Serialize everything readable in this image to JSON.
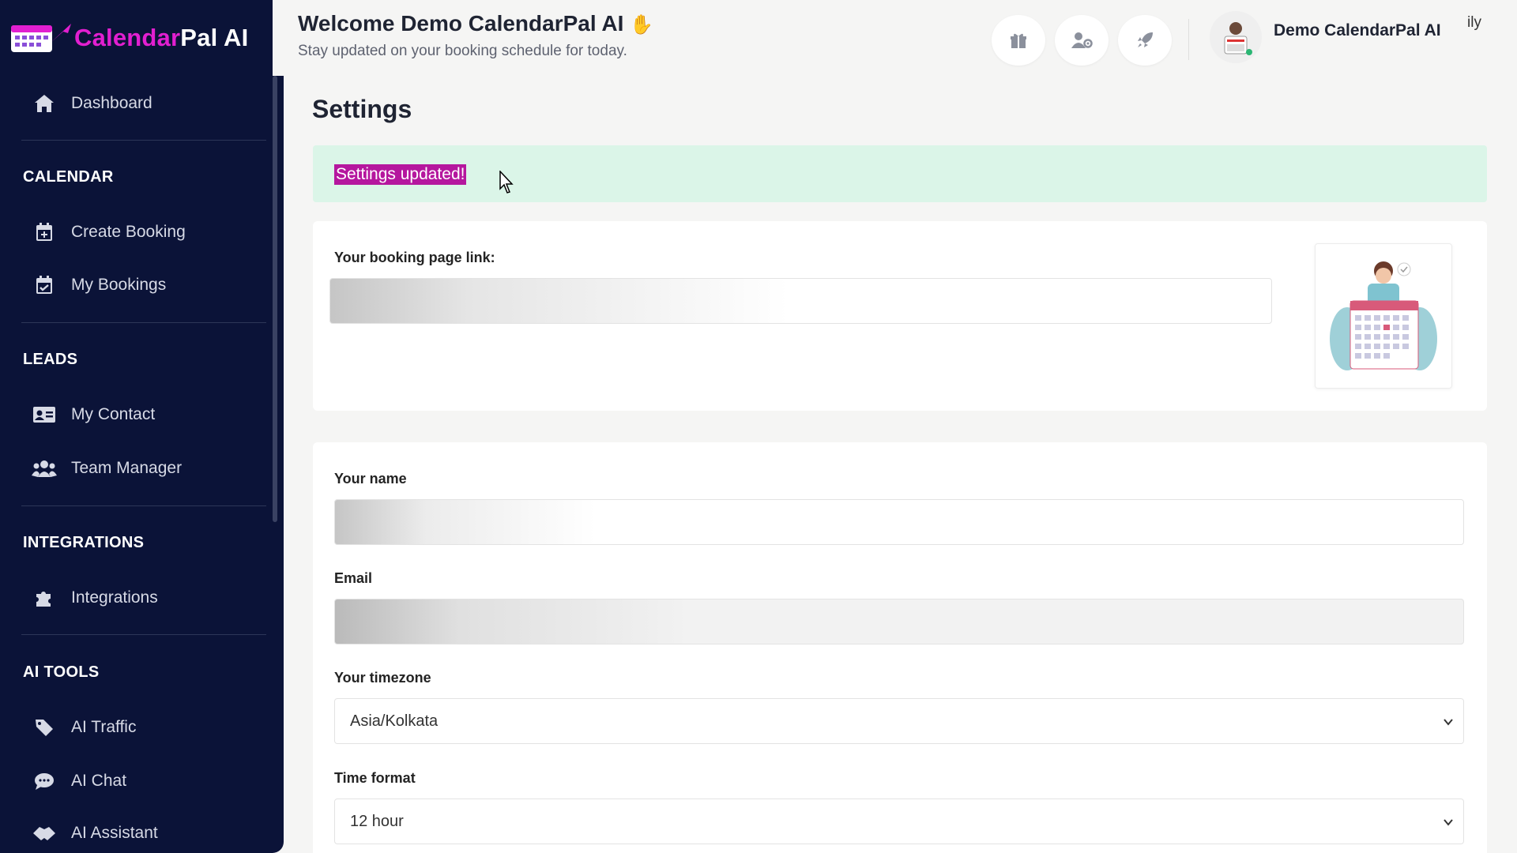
{
  "app": {
    "logo_part1": "Calendar",
    "logo_part2": "Pal AI"
  },
  "header": {
    "welcome": "Welcome Demo CalendarPal AI",
    "wave_emoji": "✋",
    "subtitle": "Stay updated on your booking schedule for today.",
    "user_name": "Demo CalendarPal AI",
    "corner_text": "ily"
  },
  "sidebar": {
    "items": [
      {
        "label": "Dashboard",
        "icon": "home-icon"
      },
      {
        "section": "CALENDAR"
      },
      {
        "label": "Create Booking",
        "icon": "calendar-plus-icon"
      },
      {
        "label": "My Bookings",
        "icon": "calendar-check-icon"
      },
      {
        "section": "LEADS"
      },
      {
        "label": "My Contact",
        "icon": "contact-card-icon"
      },
      {
        "label": "Team Manager",
        "icon": "users-icon"
      },
      {
        "section": "INTEGRATIONS"
      },
      {
        "label": "Integrations",
        "icon": "puzzle-icon"
      },
      {
        "section": "AI TOOLS"
      },
      {
        "label": "AI Traffic",
        "icon": "tag-icon"
      },
      {
        "label": "AI Chat",
        "icon": "chat-icon"
      },
      {
        "label": "AI Assistant",
        "icon": "handshake-icon"
      }
    ]
  },
  "main": {
    "page_title": "Settings",
    "alert": "Settings updated!",
    "booking_link_label": "Your booking page link:",
    "name_label": "Your name",
    "email_label": "Email",
    "timezone_label": "Your timezone",
    "timezone_value": "Asia/Kolkata",
    "time_format_label": "Time format",
    "time_format_value": "12 hour"
  },
  "colors": {
    "sidebar_bg": "#0b1338",
    "brand_pink": "#e21fd0",
    "alert_bg": "#dbf5e8",
    "highlight": "#b5179e"
  }
}
